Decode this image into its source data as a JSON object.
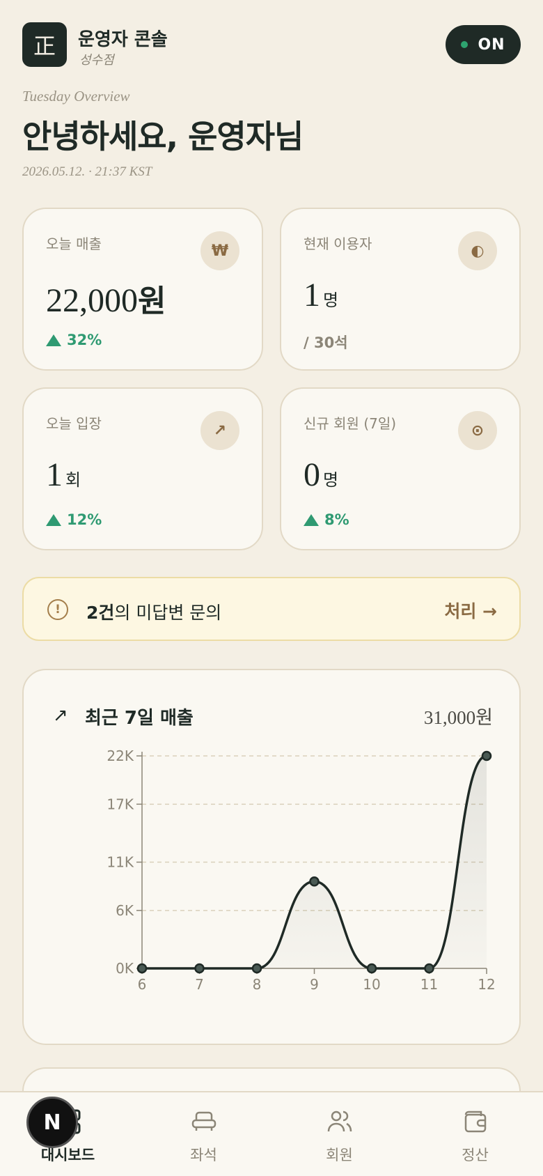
{
  "header": {
    "logo_char": "正",
    "title": "운영자 콘솔",
    "branch": "성수점",
    "status": "ON"
  },
  "overview": {
    "label": "Tuesday Overview",
    "greeting": "안녕하세요, 운영자님",
    "datetime": "2026.05.12. · 21:37 KST"
  },
  "stats": {
    "revenue": {
      "label": "오늘 매출",
      "icon": "₩",
      "value": "22,000",
      "unit": "원",
      "trend": "32%"
    },
    "users": {
      "label": "현재 이용자",
      "icon": "◐",
      "value": "1",
      "unit": "명",
      "sub": "/ 30석"
    },
    "entries": {
      "label": "오늘 입장",
      "icon": "↗",
      "value": "1",
      "unit": "회",
      "trend": "12%"
    },
    "new_members": {
      "label": "신규 회원 (7일)",
      "icon": "⊙",
      "value": "0",
      "unit": "명",
      "trend": "8%"
    }
  },
  "alert": {
    "icon": "!",
    "count": "2건",
    "text": "의 미답변 문의",
    "action": "처리 →"
  },
  "chart_section": {
    "title": "최근 7일 매출",
    "total": "31,000원"
  },
  "chart_data": {
    "type": "area",
    "x": [
      "6",
      "7",
      "8",
      "9",
      "10",
      "11",
      "12"
    ],
    "values": [
      0,
      0,
      0,
      9000,
      0,
      0,
      22000
    ],
    "ylim": [
      0,
      22000
    ],
    "yticks": [
      0,
      6000,
      11000,
      17000,
      22000
    ],
    "yticklabels": [
      "0K",
      "6K",
      "11K",
      "17K",
      "22K"
    ],
    "grid": true,
    "line_color": "#1f2a26"
  },
  "nav": {
    "fab": "N",
    "items": [
      {
        "label": "대시보드",
        "icon": "grid-icon"
      },
      {
        "label": "좌석",
        "icon": "seat-icon"
      },
      {
        "label": "회원",
        "icon": "users-icon"
      },
      {
        "label": "정산",
        "icon": "wallet-icon"
      }
    ]
  },
  "colors": {
    "background": "#f4efe4",
    "card": "#faf8f2",
    "accent": "#1f2a26",
    "positive": "#2f9a72",
    "brown": "#8a6a43"
  }
}
